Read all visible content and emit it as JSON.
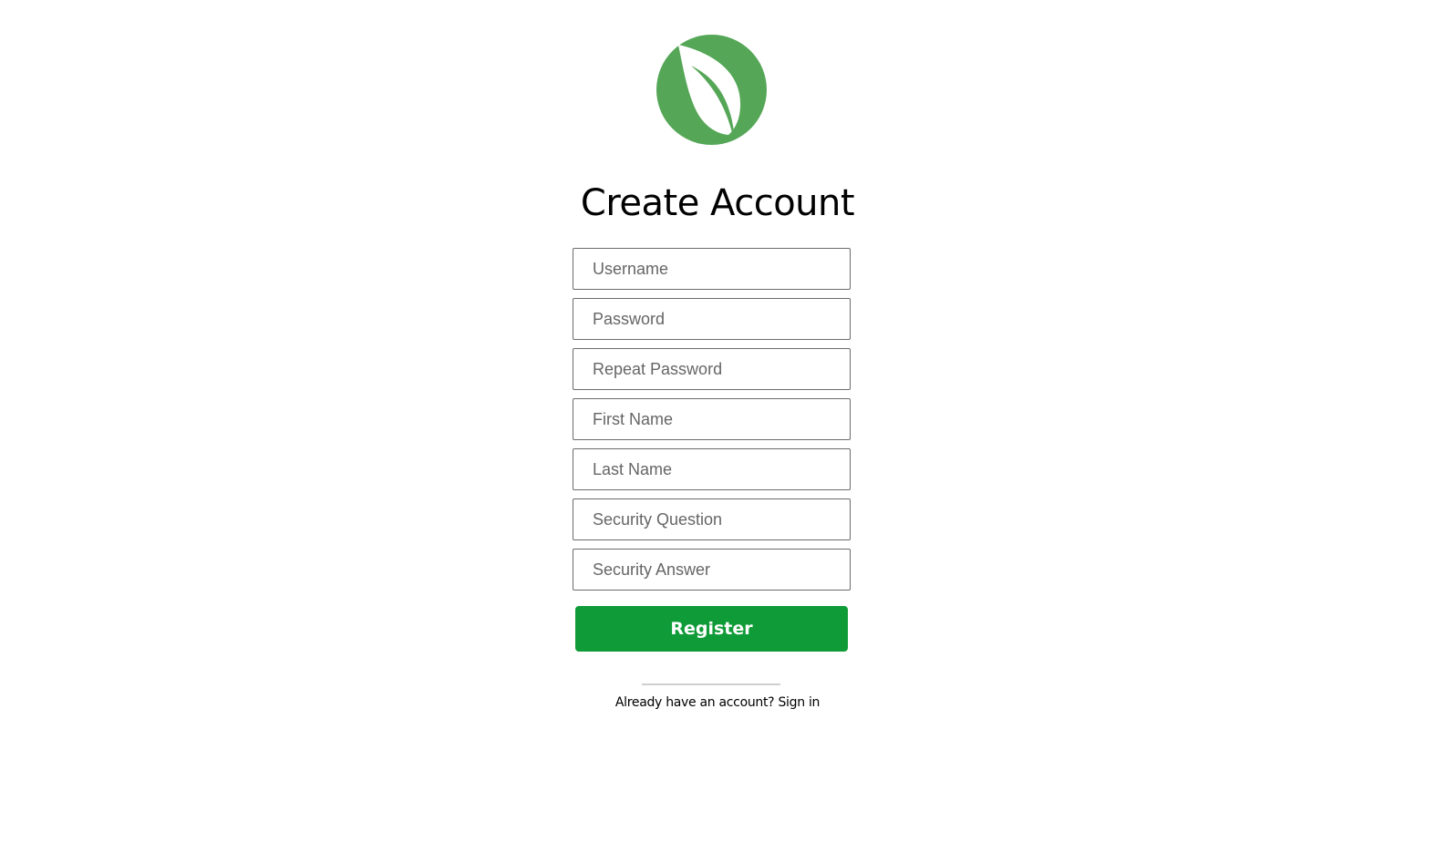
{
  "brand": {
    "logo_icon": "leaf-icon",
    "logo_color": "#55a757"
  },
  "page": {
    "title": "Create Account"
  },
  "form": {
    "fields": [
      {
        "name": "username",
        "placeholder": "Username",
        "value": ""
      },
      {
        "name": "password",
        "placeholder": "Password",
        "value": ""
      },
      {
        "name": "repeat_password",
        "placeholder": "Repeat Password",
        "value": ""
      },
      {
        "name": "first_name",
        "placeholder": "First Name",
        "value": ""
      },
      {
        "name": "last_name",
        "placeholder": "Last Name",
        "value": ""
      },
      {
        "name": "security_question",
        "placeholder": "Security Question",
        "value": ""
      },
      {
        "name": "security_answer",
        "placeholder": "Security Answer",
        "value": ""
      }
    ],
    "submit_label": "Register",
    "submit_color": "#0f9b37"
  },
  "footer": {
    "prompt_text": "Already have an account?",
    "signin_label": "Sign in"
  }
}
